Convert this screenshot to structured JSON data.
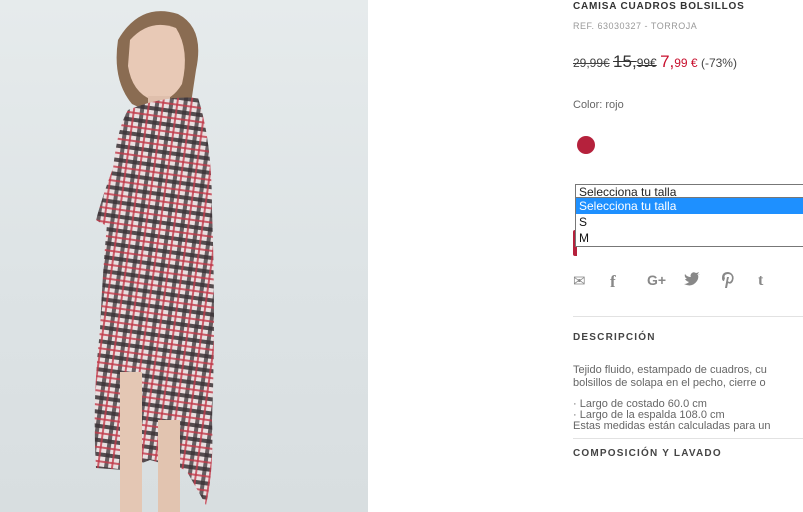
{
  "product": {
    "title": "CAMISA CUADROS BOLSILLOS",
    "ref": "REF. 63030327 - TORROJA",
    "price_original": "29,99€",
    "price_previous_int": "15,",
    "price_previous_dec": "99€",
    "price_current_int": "7,",
    "price_current_dec": "99 €",
    "discount": "(-73%)",
    "color_label": "Color: rojo",
    "swatch_color": "#b5213c"
  },
  "size_select": {
    "current": "Selecciona tu talla",
    "options": [
      "Selecciona tu talla",
      "S",
      "M"
    ]
  },
  "share": {
    "icons": [
      "email-icon",
      "facebook-icon",
      "google-plus-icon",
      "twitter-icon",
      "pinterest-icon",
      "tumblr-icon"
    ],
    "glyphs": [
      "✉",
      "f",
      "G+",
      "🐦",
      "𝓅",
      "t"
    ]
  },
  "description": {
    "heading": "DESCRIPCIÓN",
    "line1": "Tejido fluido, estampado de cuadros, cu",
    "line2": "bolsillos de solapa en el pecho, cierre o",
    "measure1": "· Largo de costado 60.0 cm",
    "measure2": "· Largo de la espalda 108.0 cm",
    "measure_note": "Estas medidas están calculadas para un"
  },
  "composition": {
    "heading": "COMPOSICIÓN Y LAVADO"
  }
}
